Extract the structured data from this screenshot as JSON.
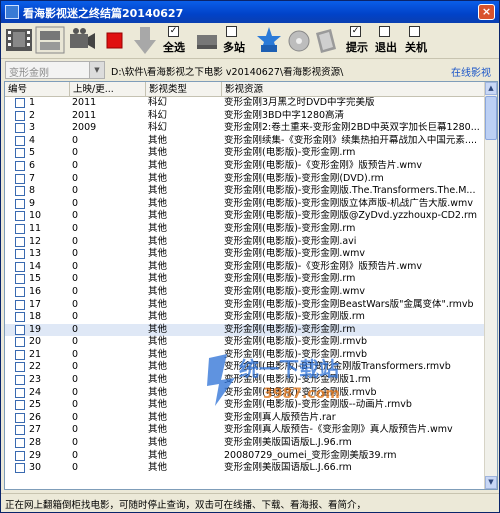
{
  "window": {
    "title": "看海影视迷之终结篇20140627",
    "close_label": "×"
  },
  "toolbar": {
    "select_all_label": "全选",
    "multi_site_label": "多站",
    "tips_label": "提示",
    "exit_label": "退出",
    "shutdown_label": "关机",
    "select_all_checked": true,
    "multi_site_checked": false,
    "tips_checked": true,
    "exit_checked": false,
    "shutdown_checked": false
  },
  "addressbar": {
    "search_value": "变形金刚",
    "path": "D:\\软件\\看海影视之下电影 v20140627\\看海影视资源\\",
    "online_link": "在线影视"
  },
  "grid": {
    "columns": [
      "编号",
      "上映/更...",
      "影视类型",
      "影视资源"
    ],
    "rows": [
      {
        "num": "1",
        "year": "2011",
        "type": "科幻",
        "res": "变形金刚3月黑之时DVD中字完美版"
      },
      {
        "num": "2",
        "year": "2011",
        "type": "科幻",
        "res": "变形金刚3BD中字1280高清"
      },
      {
        "num": "3",
        "year": "2009",
        "type": "科幻",
        "res": "变形金刚2:卷土重来-变形金刚2BD中英双字加长巨幕1280..."
      },
      {
        "num": "4",
        "year": "0",
        "type": "其他",
        "res": "变形金刚续集-《变形金刚》续集热拍开幕战加入中国元素...."
      },
      {
        "num": "5",
        "year": "0",
        "type": "其他",
        "res": "变形金刚(电影版)-变形金刚.rm"
      },
      {
        "num": "6",
        "year": "0",
        "type": "其他",
        "res": "变形金刚(电影版)-《变形金刚》版预告片.wmv"
      },
      {
        "num": "7",
        "year": "0",
        "type": "其他",
        "res": "变形金刚(电影版)-变形金刚(DVD).rm"
      },
      {
        "num": "8",
        "year": "0",
        "type": "其他",
        "res": "变形金刚(电影版)-变形金刚版.The.Transformers.The.M..."
      },
      {
        "num": "9",
        "year": "0",
        "type": "其他",
        "res": "变形金刚(电影版)-变形金刚版立体声版-机战广告大版.wmv"
      },
      {
        "num": "10",
        "year": "0",
        "type": "其他",
        "res": "变形金刚(电影版)-变形金刚版@ZyDvd.yzzhouxp-CD2.rm"
      },
      {
        "num": "11",
        "year": "0",
        "type": "其他",
        "res": "变形金刚(电影版)-变形金刚.rm"
      },
      {
        "num": "12",
        "year": "0",
        "type": "其他",
        "res": "变形金刚(电影版)-变形金刚.avi"
      },
      {
        "num": "13",
        "year": "0",
        "type": "其他",
        "res": "变形金刚(电影版)-变形金刚.wmv"
      },
      {
        "num": "14",
        "year": "0",
        "type": "其他",
        "res": "变形金刚(电影版)-《变形金刚》版预告片.wmv"
      },
      {
        "num": "15",
        "year": "0",
        "type": "其他",
        "res": "变形金刚(电影版)-变形金刚.rm"
      },
      {
        "num": "16",
        "year": "0",
        "type": "其他",
        "res": "变形金刚(电影版)-变形金刚.wmv"
      },
      {
        "num": "17",
        "year": "0",
        "type": "其他",
        "res": "变形金刚(电影版)-变形金刚BeastWars版\"金属变体\".rmvb"
      },
      {
        "num": "18",
        "year": "0",
        "type": "其他",
        "res": "变形金刚(电影版)-变形金刚版.rm"
      },
      {
        "num": "19",
        "year": "0",
        "type": "其他",
        "res": "变形金刚(电影版)-变形金刚.rm"
      },
      {
        "num": "20",
        "year": "0",
        "type": "其他",
        "res": "变形金刚(电影版)-变形金刚.rmvb"
      },
      {
        "num": "21",
        "year": "0",
        "type": "其他",
        "res": "变形金刚(电影版)-变形金刚.rmvb"
      },
      {
        "num": "22",
        "year": "0",
        "type": "其他",
        "res": "变形金刚(电影版)-BT变形金刚版Transformers.rmvb"
      },
      {
        "num": "23",
        "year": "0",
        "type": "其他",
        "res": "变形金刚(电影版)-变形金刚版1.rm"
      },
      {
        "num": "24",
        "year": "0",
        "type": "其他",
        "res": "变形金刚(电影版)-变形金刚版.rmvb"
      },
      {
        "num": "25",
        "year": "0",
        "type": "其他",
        "res": "变形金刚(电影版)-变形金刚版--动画片.rmvb"
      },
      {
        "num": "26",
        "year": "0",
        "type": "其他",
        "res": "变形金刚真人版预告片.rar"
      },
      {
        "num": "27",
        "year": "0",
        "type": "其他",
        "res": "变形金刚真人版预告-《变形金刚》真人版预告片.wmv"
      },
      {
        "num": "28",
        "year": "0",
        "type": "其他",
        "res": "变形金刚美版国语版L.J.96.rm"
      },
      {
        "num": "29",
        "year": "0",
        "type": "其他",
        "res": "20080729_oumei_变形金刚美版39.rm"
      },
      {
        "num": "30",
        "year": "0",
        "type": "其他",
        "res": "变形金刚美版国语版L.J.66.rm"
      }
    ],
    "selected_row": "19"
  },
  "statusbar": {
    "text": "正在网上翻箱倒柜找电影，可随时停止查询，双击可在线播、下载、看海报、看简介，"
  },
  "watermark": {
    "brand": "统一下载站",
    "site": "3987.com"
  },
  "colors": {
    "title_bar": "#0142c8",
    "stop_button": "#e01010",
    "link": "#1a55c8"
  }
}
